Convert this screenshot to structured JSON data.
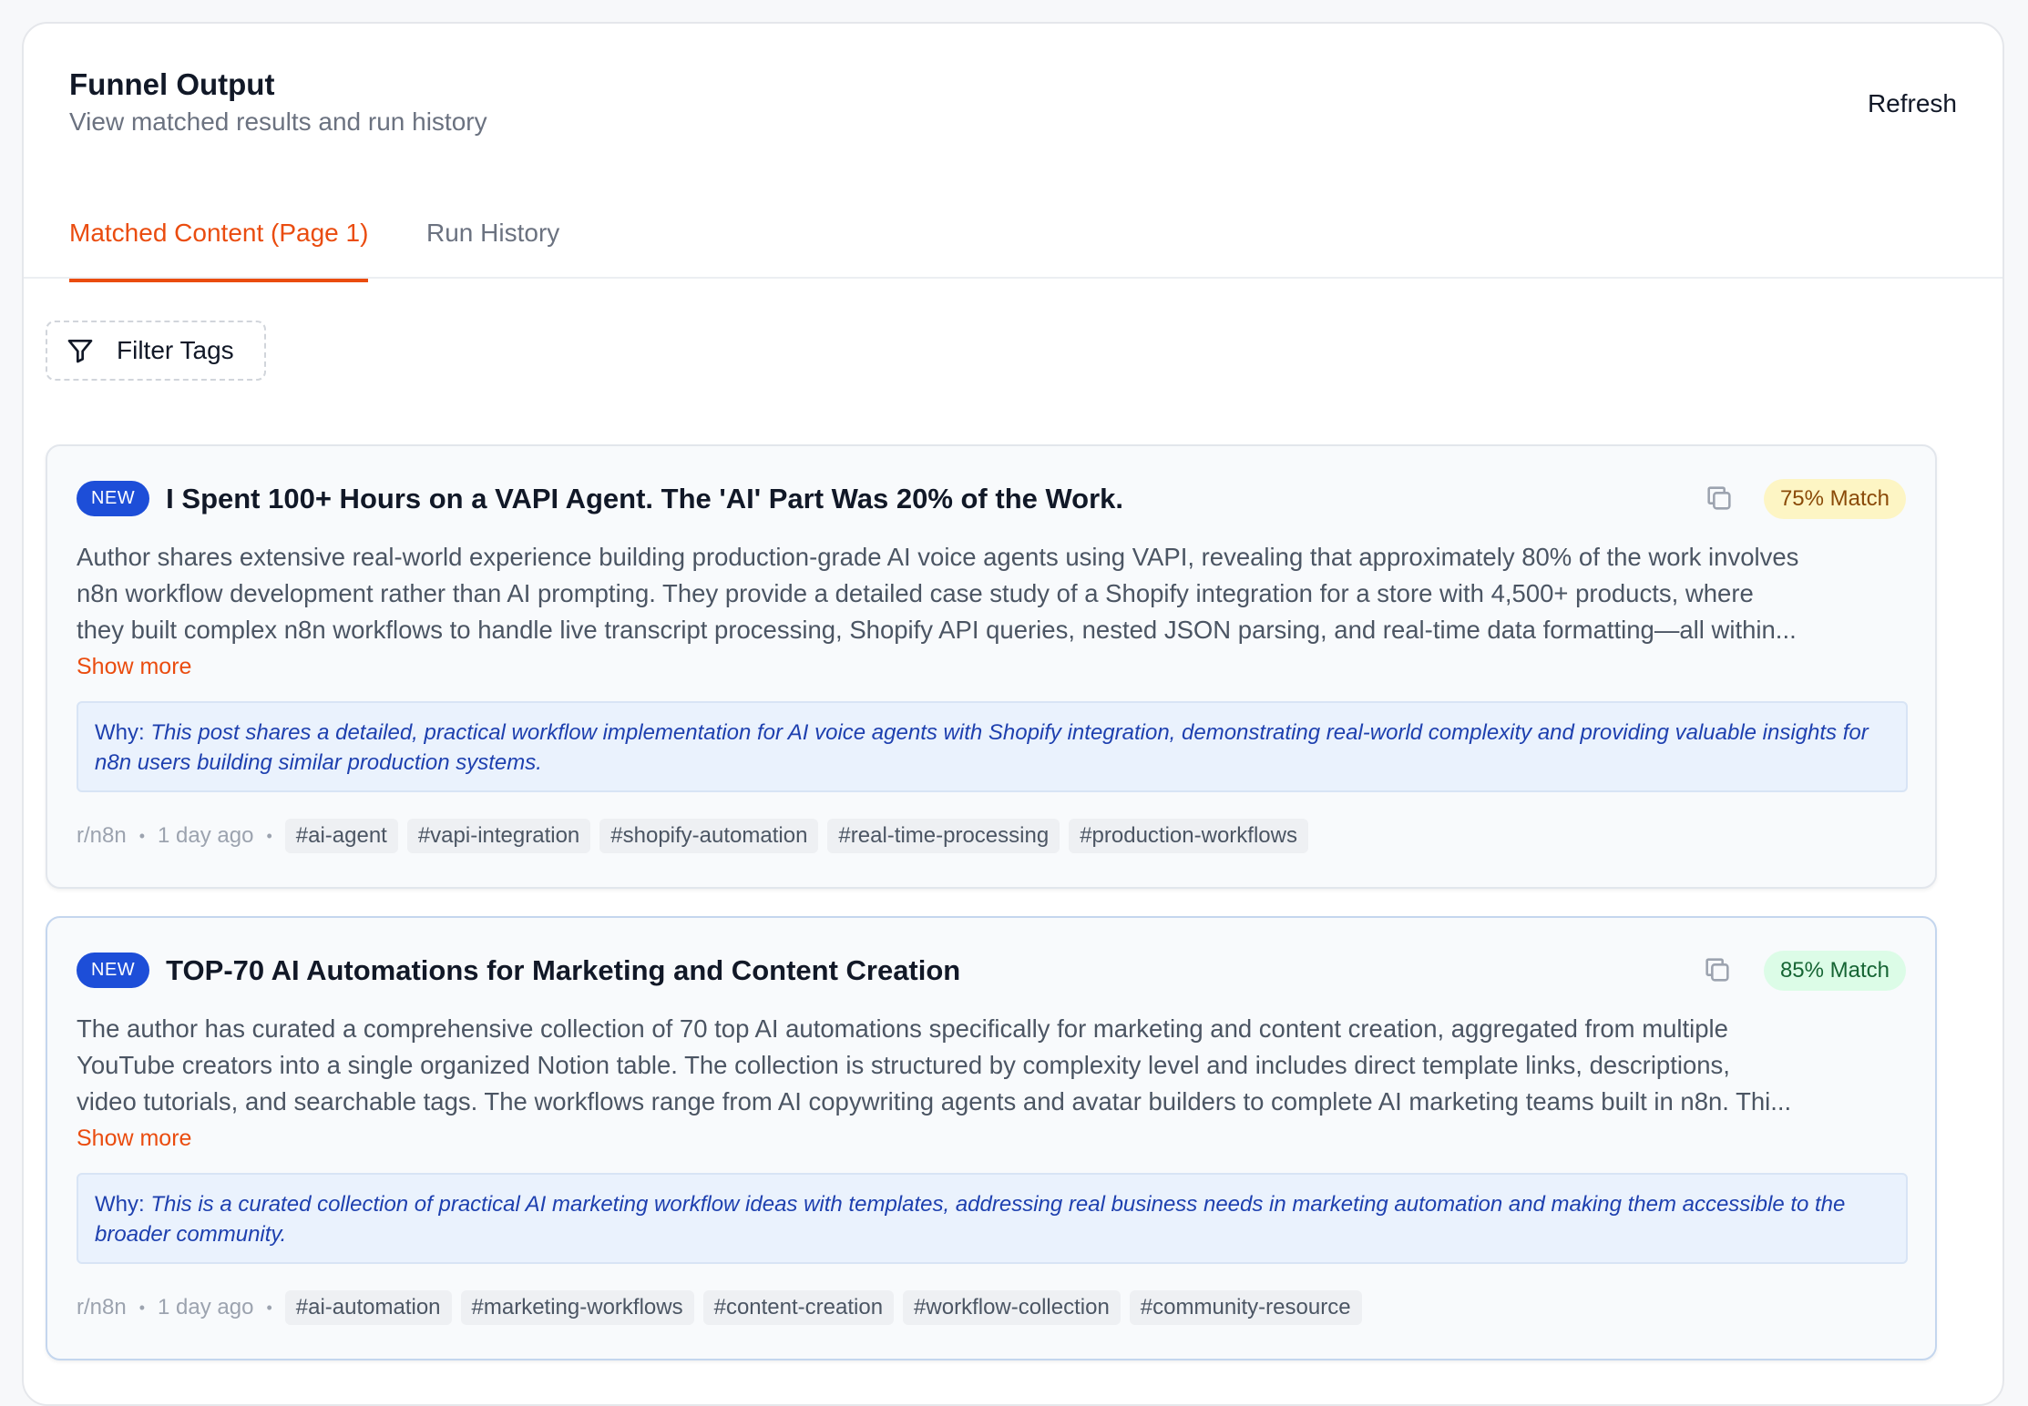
{
  "header": {
    "title": "Funnel Output",
    "subtitle": "View matched results and run history",
    "refresh_label": "Refresh"
  },
  "tabs": [
    {
      "label": "Matched Content (Page 1)",
      "active": true
    },
    {
      "label": "Run History",
      "active": false
    }
  ],
  "filter": {
    "label": "Filter Tags",
    "icon": "filter-icon"
  },
  "cards": [
    {
      "badge": "NEW",
      "title": "I Spent 100+ Hours on a VAPI Agent. The 'AI' Part Was 20% of the Work.",
      "match": "75% Match",
      "match_color": "#fdf5c4",
      "description_lines": [
        "Author shares extensive real-world experience building production-grade AI voice agents using VAPI, revealing that approximately 80% of the work involves",
        "n8n workflow development rather than AI prompting. They provide a detailed case study of a Shopify integration for a store with 4,500+ products, where",
        "they built complex n8n workflows to handle live transcript processing, Shopify API queries, nested JSON parsing, and real-time data formatting—all within..."
      ],
      "show_more": "Show more",
      "why_label": "Why:",
      "why_text": "This post shares a detailed, practical workflow implementation for AI voice agents with Shopify integration, demonstrating real-world complexity and providing valuable insights for n8n users building similar production systems.",
      "source": "r/n8n",
      "time": "1 day ago",
      "tags": [
        "#ai-agent",
        "#vapi-integration",
        "#shopify-automation",
        "#real-time-processing",
        "#production-workflows"
      ]
    },
    {
      "badge": "NEW",
      "title": "TOP-70 AI Automations for Marketing and Content Creation",
      "match": "85% Match",
      "match_color": "#dcfce7",
      "description_lines": [
        "The author has curated a comprehensive collection of 70 top AI automations specifically for marketing and content creation, aggregated from multiple",
        "YouTube creators into a single organized Notion table. The collection is structured by complexity level and includes direct template links, descriptions,",
        "video tutorials, and searchable tags. The workflows range from AI copywriting agents and avatar builders to complete AI marketing teams built in n8n. Thi..."
      ],
      "show_more": "Show more",
      "why_label": "Why:",
      "why_text": "This is a curated collection of practical AI marketing workflow ideas with templates, addressing real business needs in marketing automation and making them accessible to the broader community.",
      "source": "r/n8n",
      "time": "1 day ago",
      "tags": [
        "#ai-automation",
        "#marketing-workflows",
        "#content-creation",
        "#workflow-collection",
        "#community-resource"
      ]
    }
  ],
  "colors": {
    "accent": "#ea4c0f",
    "badge_blue": "#1d4ed8",
    "why_text": "#1e40af"
  }
}
